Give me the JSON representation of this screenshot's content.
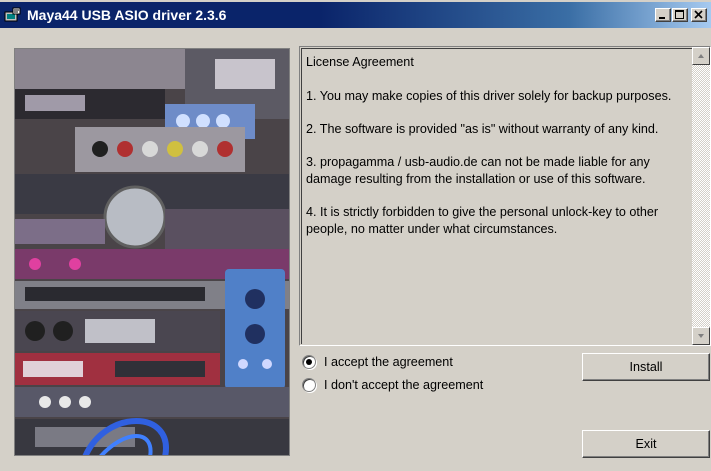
{
  "window": {
    "title": "Maya44 USB ASIO driver 2.3.6"
  },
  "icons": {
    "app": "installer-icon",
    "minimize": "minimize-icon",
    "maximize": "maximize-icon",
    "close": "close-icon",
    "scroll_up": "scroll-up-arrow-icon",
    "scroll_down": "scroll-down-arrow-icon"
  },
  "license": {
    "heading": "License Agreement",
    "clauses": [
      "1. You may make copies of this driver solely for backup purposes.",
      "2. The software is provided \"as is\" without warranty of any kind.",
      "3. propagamma / usb-audio.de can not be made liable for any damage resulting from the installation or use of this software.",
      "4. It is strictly forbidden to give the personal unlock-key to other people, no matter under what circumstances."
    ]
  },
  "options": {
    "accept": {
      "label": "I accept the agreement",
      "selected": true
    },
    "decline": {
      "label": "I don't accept the agreement",
      "selected": false
    }
  },
  "buttons": {
    "install": "Install",
    "exit": "Exit"
  },
  "colors": {
    "titlebar_start": "#0a246a",
    "titlebar_end": "#a6caf0",
    "face": "#d4d0c8"
  }
}
